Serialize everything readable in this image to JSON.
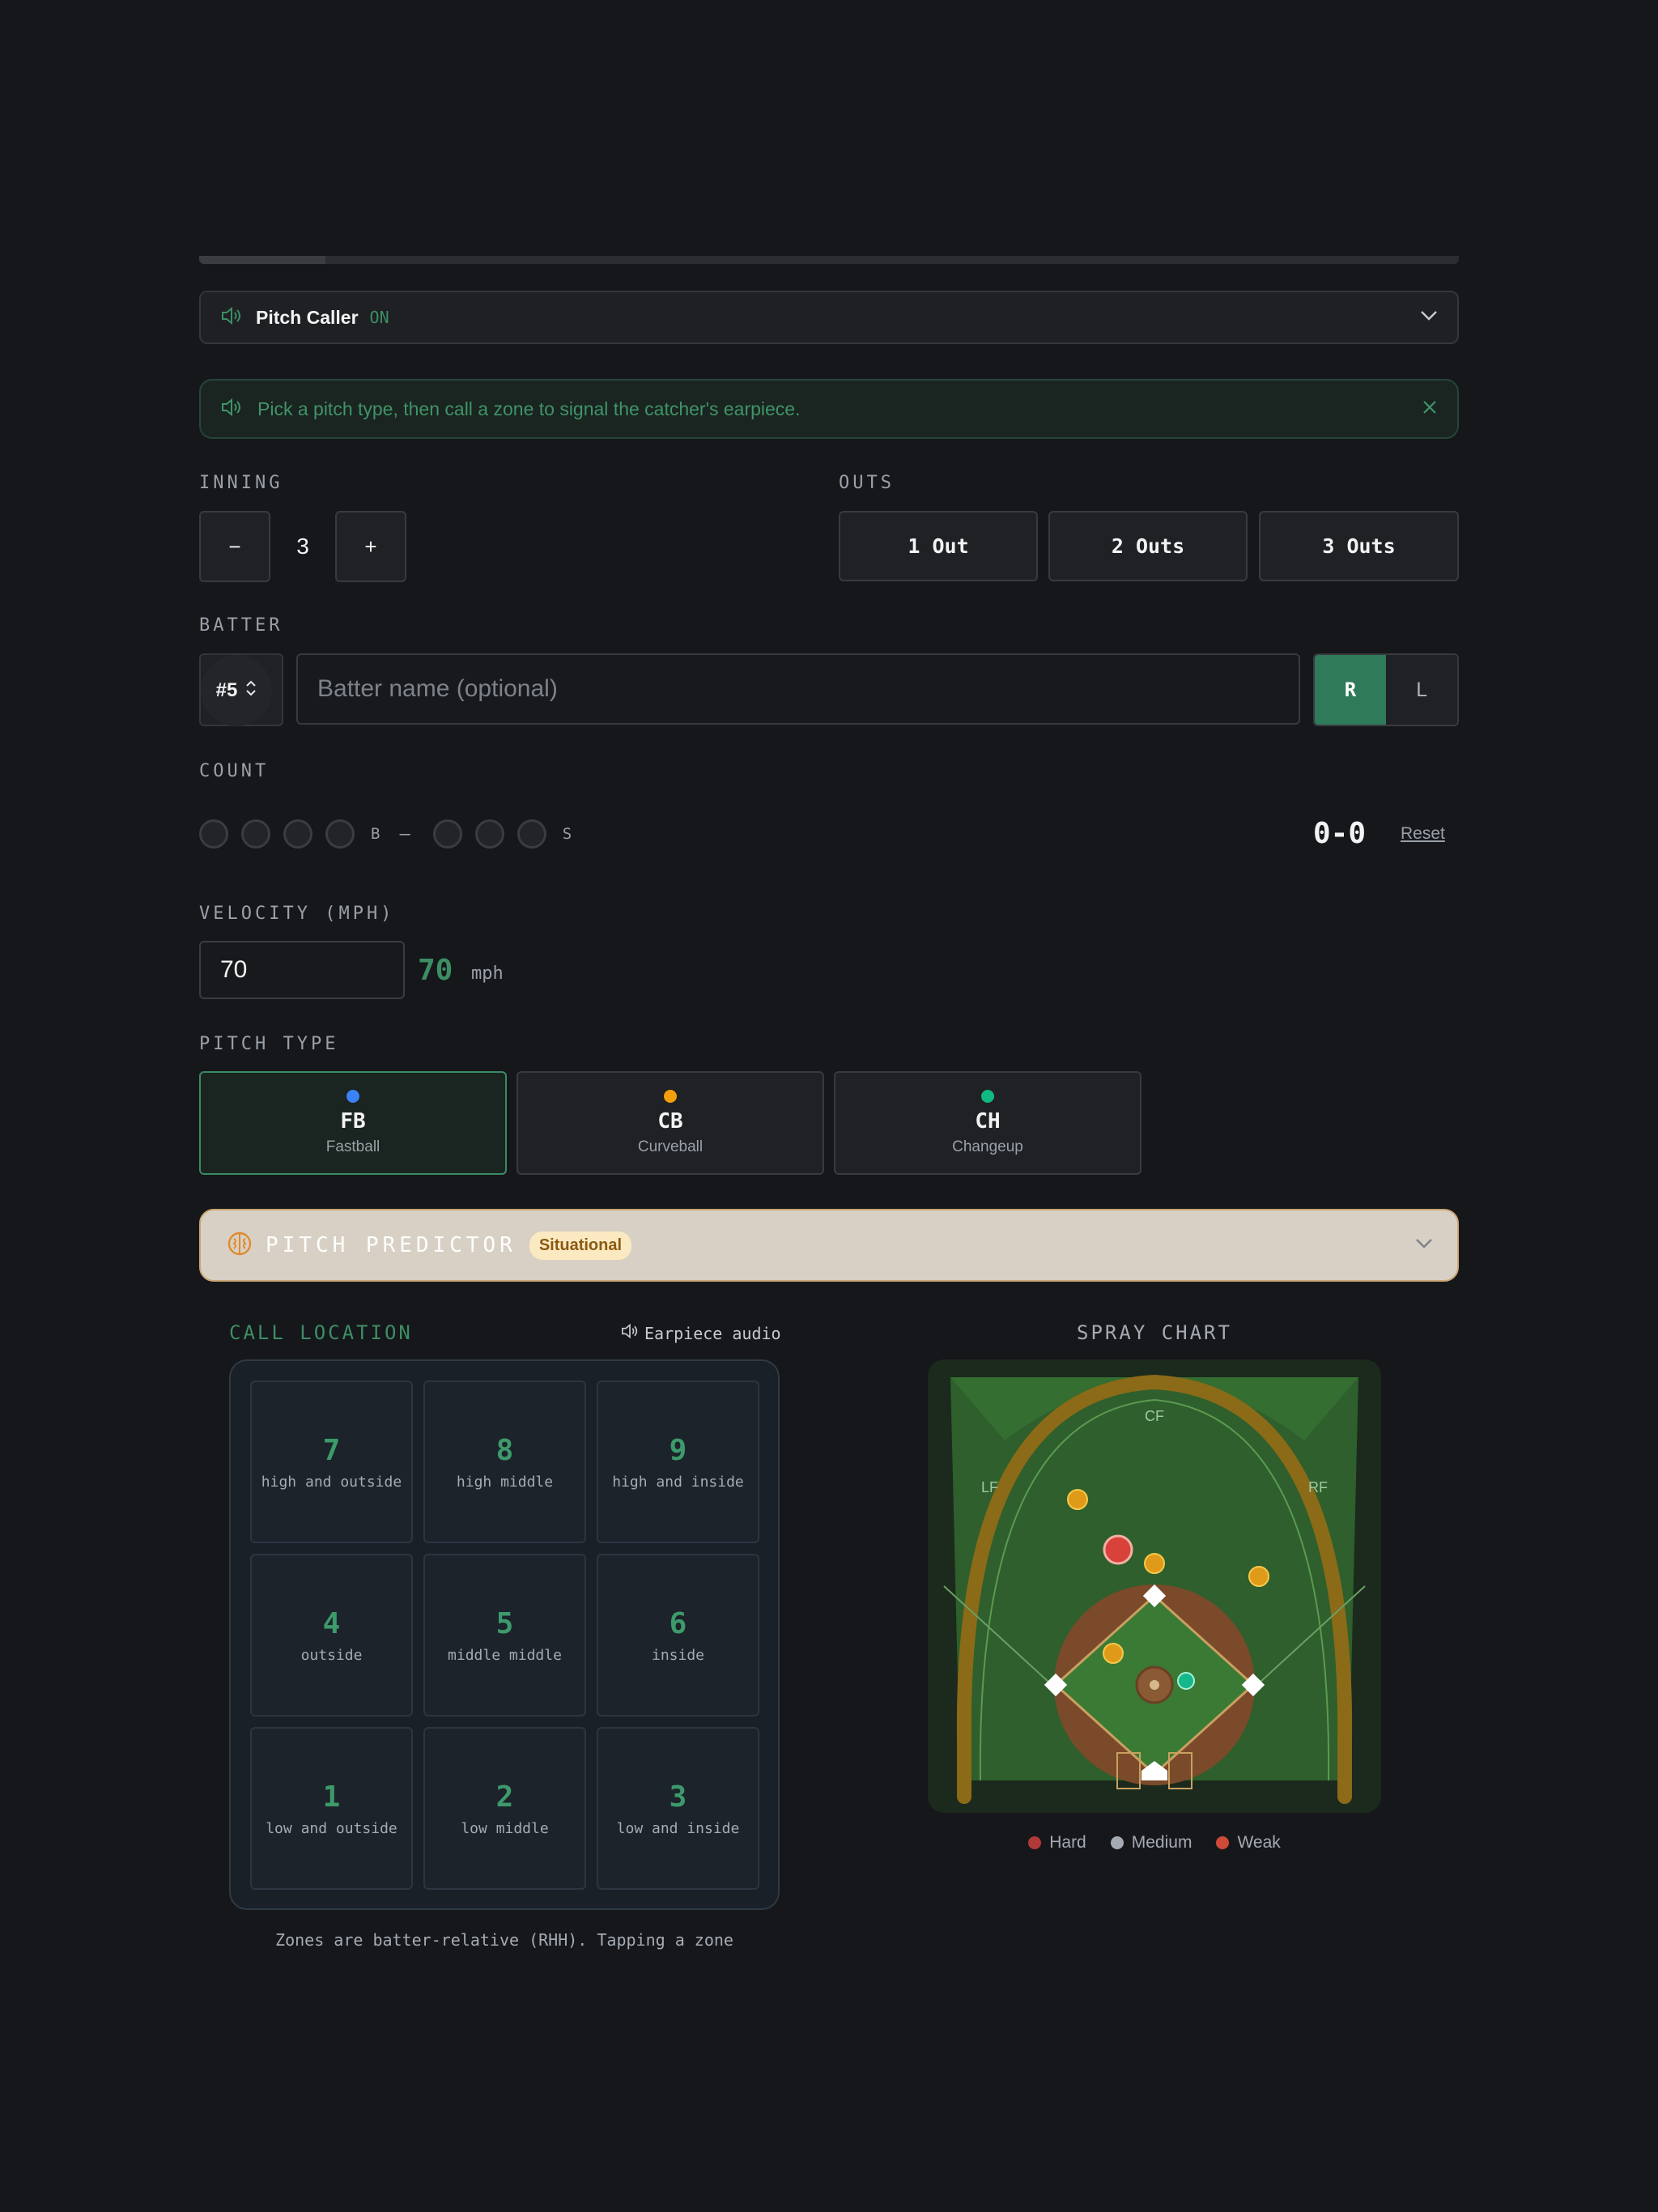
{
  "progress": {
    "fraction": 0.1
  },
  "pitch_caller": {
    "title": "Pitch Caller",
    "status": "ON",
    "icon": "speaker-icon"
  },
  "tip": {
    "text": "Pick a pitch type, then call a zone to signal the catcher's earpiece."
  },
  "inning": {
    "label": "INNING",
    "value": "3",
    "minus": "−",
    "plus": "+"
  },
  "outs": {
    "label": "OUTS",
    "options": [
      "1 Out",
      "2 Outs",
      "3 Outs"
    ]
  },
  "batter": {
    "label": "BATTER",
    "number": "#5",
    "name_placeholder": "Batter name (optional)",
    "hands": [
      "R",
      "L"
    ],
    "selected_hand": "R"
  },
  "count": {
    "label": "COUNT",
    "balls_label": "B",
    "separator": "–",
    "strikes_label": "S",
    "display": "0-0",
    "reset": "Reset",
    "balls": 0,
    "strikes": 0
  },
  "velocity": {
    "label": "VELOCITY (MPH)",
    "input": "70",
    "display": "70",
    "unit": "mph"
  },
  "pitch_type": {
    "label": "PITCH TYPE",
    "options": [
      {
        "abbr": "FB",
        "name": "Fastball",
        "color": "#3b82f6"
      },
      {
        "abbr": "CB",
        "name": "Curveball",
        "color": "#f59e0b"
      },
      {
        "abbr": "CH",
        "name": "Changeup",
        "color": "#10b981"
      }
    ],
    "selected": "FB"
  },
  "predictor": {
    "title": "PITCH PREDICTOR",
    "badge": "Situational"
  },
  "call_location": {
    "label": "CALL LOCATION",
    "audio": "Earpiece audio",
    "zones": [
      {
        "n": "7",
        "d": "high and outside"
      },
      {
        "n": "8",
        "d": "high middle"
      },
      {
        "n": "9",
        "d": "high and inside"
      },
      {
        "n": "4",
        "d": "outside"
      },
      {
        "n": "5",
        "d": "middle middle"
      },
      {
        "n": "6",
        "d": "inside"
      },
      {
        "n": "1",
        "d": "low and outside"
      },
      {
        "n": "2",
        "d": "low middle"
      },
      {
        "n": "3",
        "d": "low and inside"
      }
    ],
    "footer": "Zones are batter-relative (RHH). Tapping a zone"
  },
  "spray_chart": {
    "label": "SPRAY CHART",
    "field_labels": {
      "lf": "LF",
      "cf": "CF",
      "rf": "RF"
    },
    "legend": [
      {
        "name": "Hard",
        "color": "#b03a3a"
      },
      {
        "name": "Medium",
        "color": "#a5abb3"
      },
      {
        "name": "Weak",
        "color": "#d04a3a"
      }
    ]
  }
}
